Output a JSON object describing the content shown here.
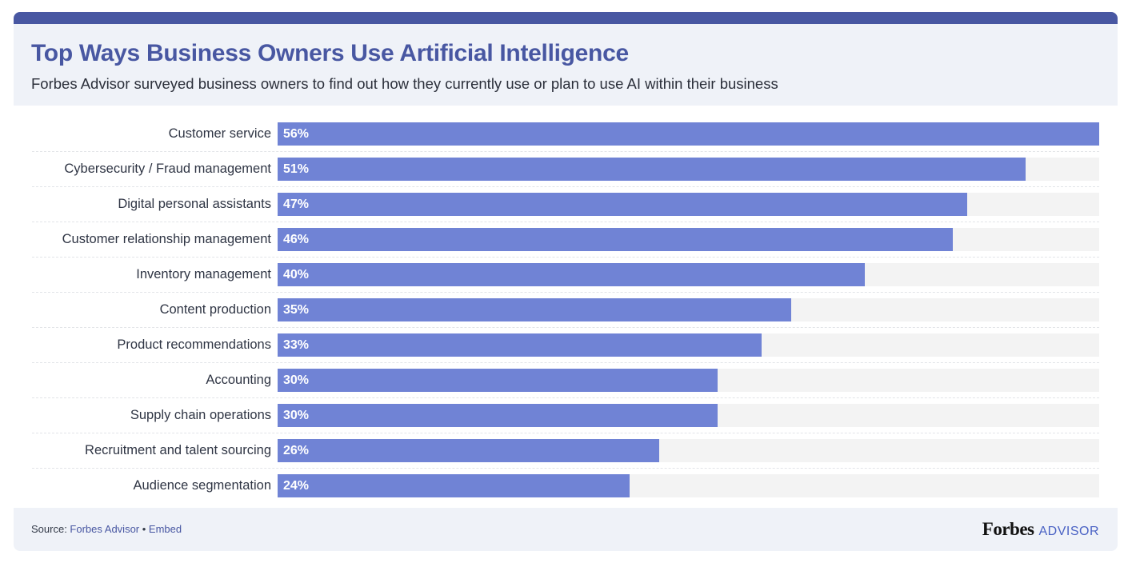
{
  "header": {
    "title": "Top Ways Business Owners Use Artificial Intelligence",
    "subtitle": "Forbes Advisor surveyed business owners to find out how they currently use or plan to use AI within their business"
  },
  "colors": {
    "accent": "#4857a2",
    "bar": "#7083d5",
    "track": "#f3f3f3",
    "panel": "#eff2f8"
  },
  "chart_data": {
    "type": "bar",
    "orientation": "horizontal",
    "title": "Top Ways Business Owners Use Artificial Intelligence",
    "subtitle": "Forbes Advisor surveyed business owners to find out how they currently use or plan to use AI within their business",
    "xlabel": "",
    "ylabel": "",
    "unit": "%",
    "xlim": [
      0,
      56
    ],
    "grid": false,
    "legend": "none",
    "categories": [
      "Customer service",
      "Cybersecurity / Fraud management",
      "Digital personal assistants",
      "Customer relationship management",
      "Inventory management",
      "Content production",
      "Product recommendations",
      "Accounting",
      "Supply chain operations",
      "Recruitment and talent sourcing",
      "Audience segmentation"
    ],
    "values": [
      56,
      51,
      47,
      46,
      40,
      35,
      33,
      30,
      30,
      26,
      24
    ],
    "labels": [
      "56%",
      "51%",
      "47%",
      "46%",
      "40%",
      "35%",
      "33%",
      "30%",
      "30%",
      "26%",
      "24%"
    ]
  },
  "footer": {
    "source_prefix": "Source: ",
    "source_link": "Forbes Advisor",
    "separator": " • ",
    "embed_link": "Embed",
    "brand_name": "Forbes",
    "brand_sub": "ADVISOR"
  }
}
